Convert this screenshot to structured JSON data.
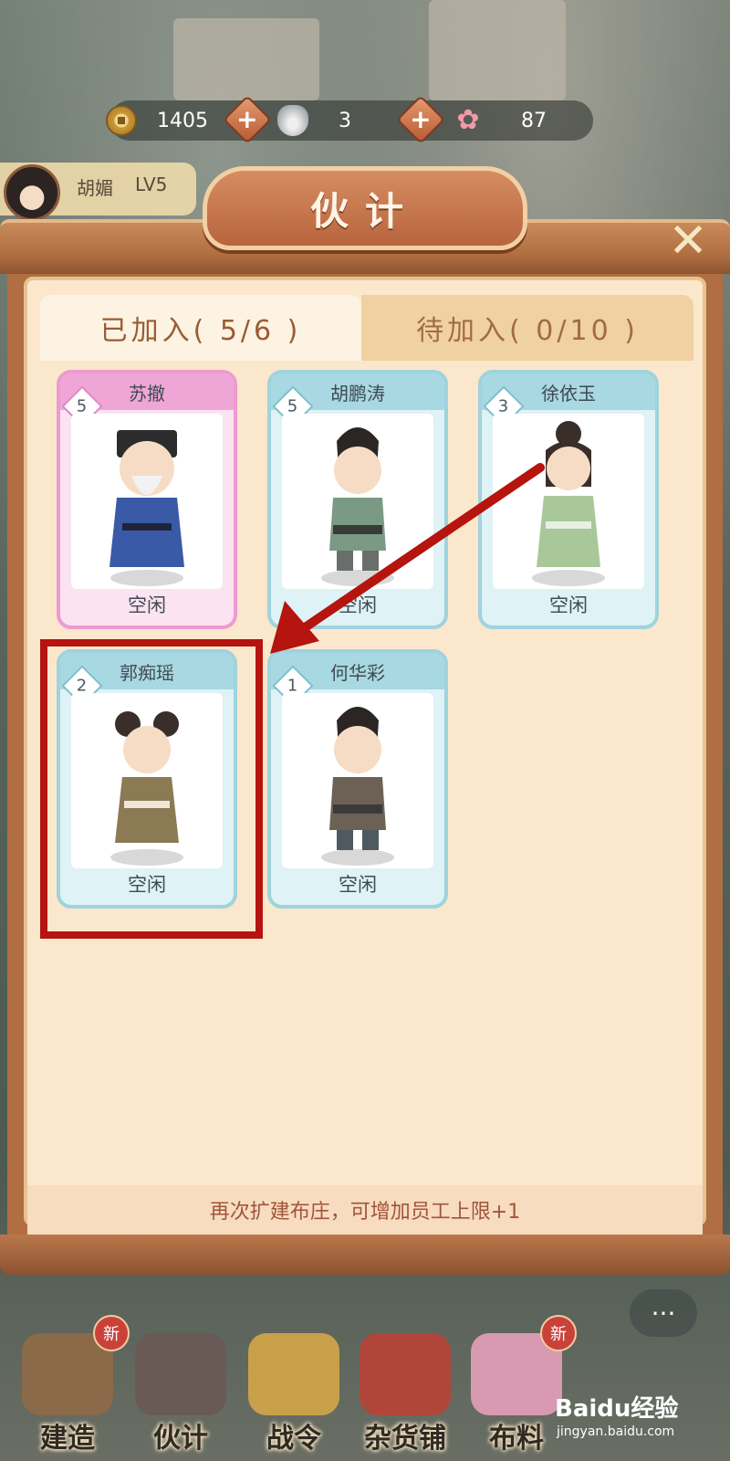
{
  "resources": {
    "coins": "1405",
    "silver": "3",
    "flowers": "87"
  },
  "player": {
    "name": "胡媚",
    "level": "LV5"
  },
  "dialog": {
    "title": "伙计"
  },
  "tabs": {
    "joined": "已加入( 5/6 )",
    "pending": "待加入( 0/10 )"
  },
  "workers": [
    {
      "name": "苏撤",
      "level": "5",
      "status": "空闲",
      "color": "#ee9ad2"
    },
    {
      "name": "胡鹏涛",
      "level": "5",
      "status": "空闲",
      "color": "#9fd3dd"
    },
    {
      "name": "徐依玉",
      "level": "3",
      "status": "空闲",
      "color": "#9fd3dd"
    },
    {
      "name": "郭痴瑶",
      "level": "2",
      "status": "空闲",
      "color": "#9fd3dd"
    },
    {
      "name": "何华彩",
      "level": "1",
      "status": "空闲",
      "color": "#9fd3dd"
    }
  ],
  "footer_note": "再次扩建布庄，可增加员工上限+1",
  "bottom_nav": [
    {
      "label": "建造",
      "badge": "新"
    },
    {
      "label": "伙计",
      "badge": ""
    },
    {
      "label": "战令",
      "badge": ""
    },
    {
      "label": "杂货铺",
      "badge": ""
    },
    {
      "label": "布料",
      "badge": "新"
    }
  ],
  "watermark": {
    "brand": "Baidu经验",
    "url": "jingyan.baidu.com"
  },
  "colors": {
    "highlight": "#b5140f",
    "panel": "#fbe7cc",
    "accent": "#b8643d"
  }
}
